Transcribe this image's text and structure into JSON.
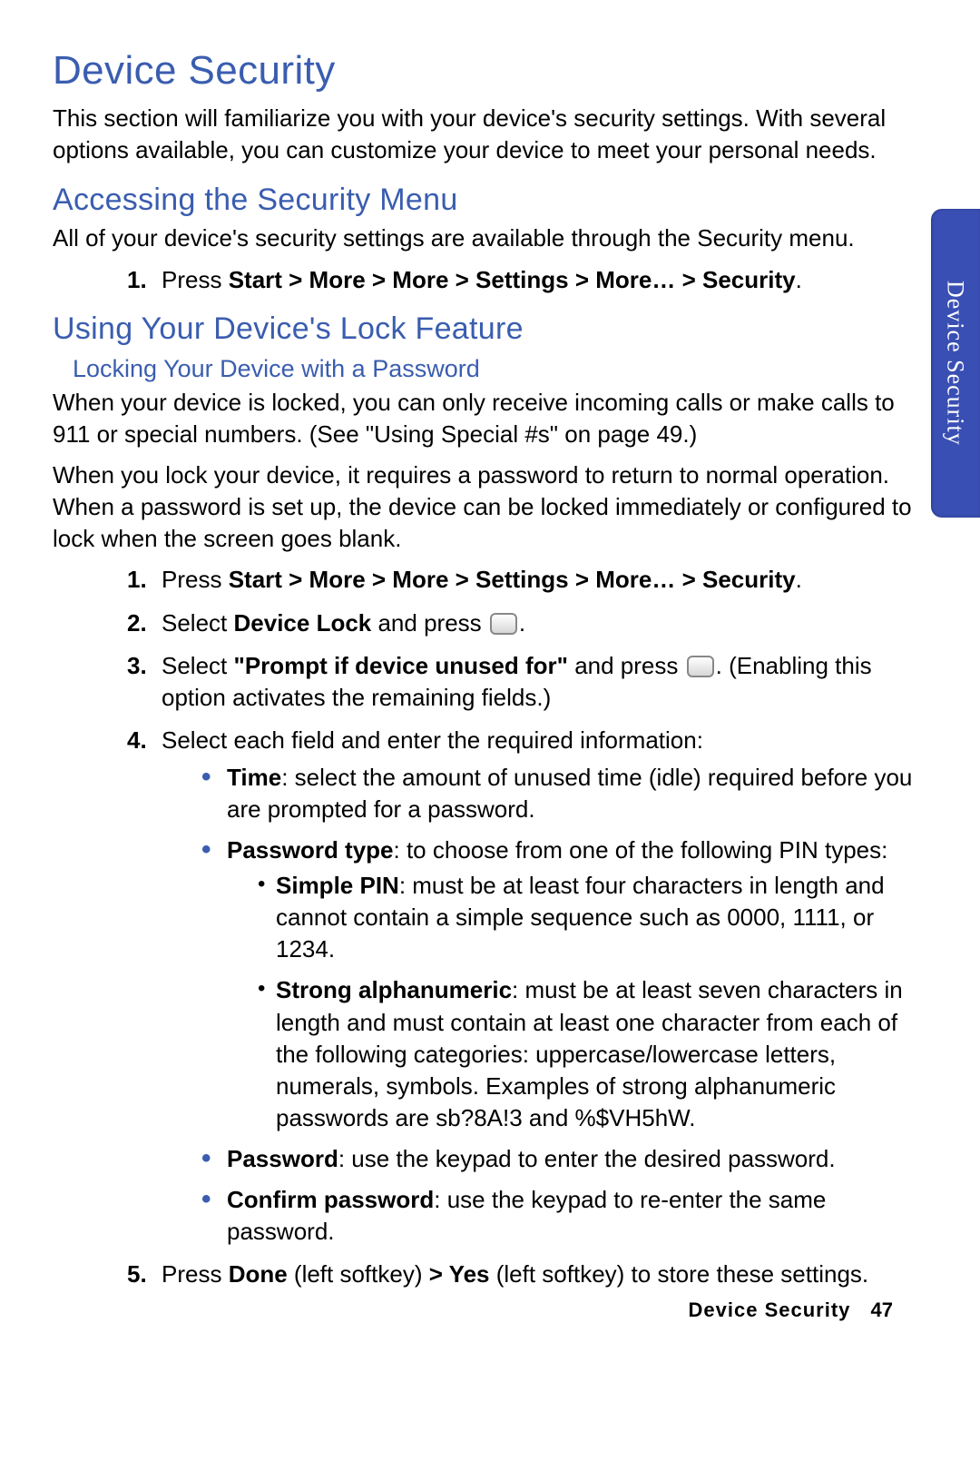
{
  "title": "Device Security",
  "intro": "This section will familiarize you with your device's security settings. With several options available, you can customize your device to meet your personal needs.",
  "sec1_heading": "Accessing the Security Menu",
  "sec1_text": "All of your device's security settings are available through the Security menu.",
  "sec1_step_num": "1.",
  "sec1_step_press": "Press ",
  "sec1_step_path": "Start > More > More > Settings > More… > Security",
  "sec1_step_period": ".",
  "sec2_heading": "Using Your Device's Lock Feature",
  "sec2_sub": "Locking Your Device with a Password",
  "sec2_p1": "When your device is locked, you can only receive incoming calls or make calls to 911 or special numbers. (See \"Using Special #s\" on page 49.)",
  "sec2_p2": "When you lock your device, it requires a password to return to normal operation. When a password is set up, the device can be locked immediately or configured to lock when the screen goes blank.",
  "s1_num": "1.",
  "s1_press": "Press ",
  "s1_path": "Start > More > More > Settings > More… > Security",
  "s1_end": ".",
  "s2_num": "2.",
  "s2_a": "Select ",
  "s2_b": "Device Lock",
  "s2_c": " and press ",
  "s2_d": ".",
  "s3_num": "3.",
  "s3_a": "Select ",
  "s3_b": "\"Prompt if device unused for\"",
  "s3_c": " and press ",
  "s3_d": ". (Enabling this option activates the remaining fields.)",
  "s4_num": "4.",
  "s4_text": "Select each field and enter the required information:",
  "b_time_l": "Time",
  "b_time_t": ": select the amount of unused time (idle) required before you are prompted for a password.",
  "b_ptype_l": "Password type",
  "b_ptype_t": ": to choose from one of the following PIN types:",
  "b_simple_l": "Simple PIN",
  "b_simple_t": ": must be at least four characters in length and cannot contain a simple sequence such as 0000, 1111, or 1234.",
  "b_strong_l": "Strong alphanumeric",
  "b_strong_t": ": must be at least seven characters in length and must contain at least one character from each of the following categories: uppercase/lowercase letters, numerals, symbols. Examples of strong alphanumeric passwords are sb?8A!3 and %$VH5hW.",
  "b_pass_l": "Password",
  "b_pass_t": ": use the keypad to enter the desired password.",
  "b_conf_l": "Confirm password",
  "b_conf_t": ": use the keypad to re-enter the same password.",
  "s5_num": "5.",
  "s5_a": "Press ",
  "s5_b": "Done",
  "s5_c": " (left softkey) ",
  "s5_d": "> Yes",
  "s5_e": " (left softkey) to store these settings.",
  "sidetab": "Device Security",
  "footer_section": "Device Security",
  "footer_page": "47"
}
